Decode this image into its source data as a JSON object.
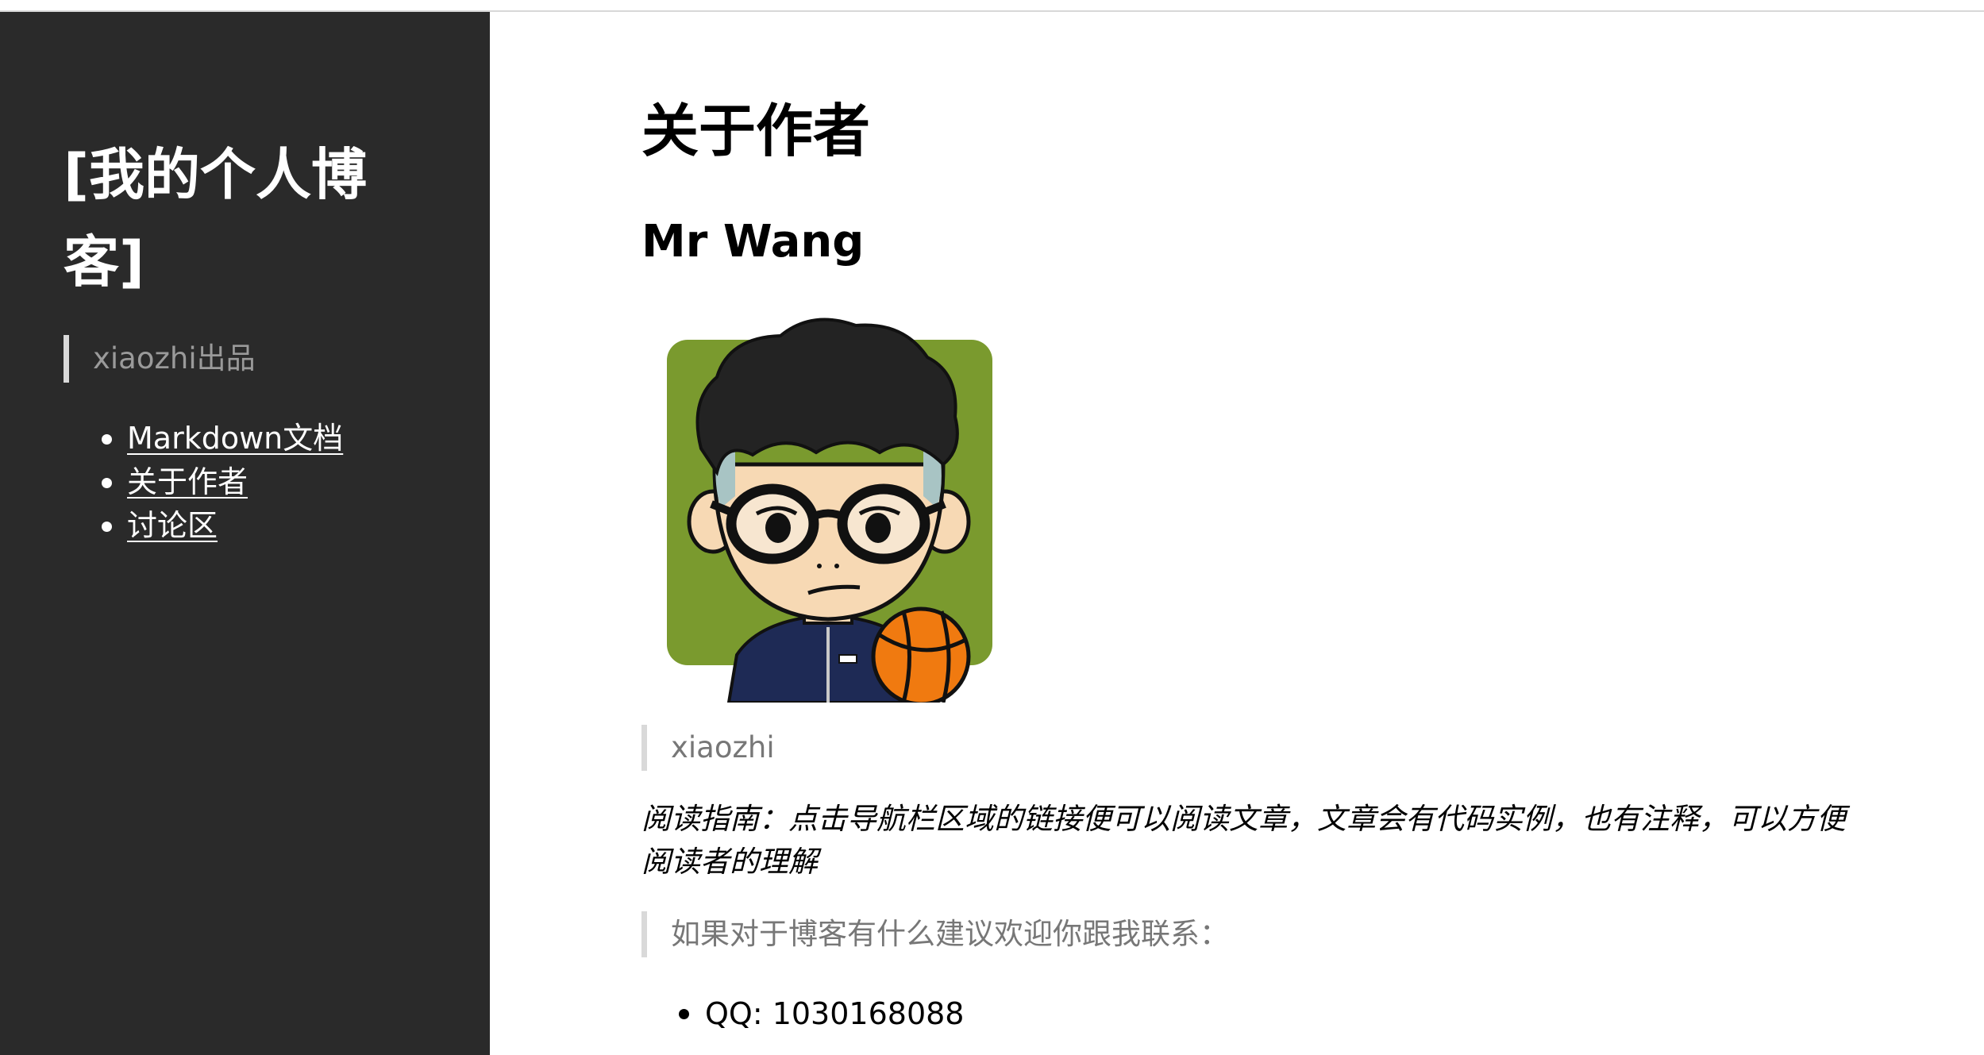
{
  "sidebar": {
    "title": "[我的个人博客]",
    "subtitle": "xiaozhi出品",
    "nav": [
      {
        "label": "Markdown文档"
      },
      {
        "label": "关于作者"
      },
      {
        "label": "讨论区"
      }
    ]
  },
  "main": {
    "heading": "关于作者",
    "author_name": "Mr Wang",
    "avatar_icon": "cartoon-avatar-basketball",
    "quote_name": "xiaozhi",
    "guide_text": "阅读指南：点击导航栏区域的链接便可以阅读文章，文章会有代码实例，也有注释，可以方便阅读者的理解",
    "contact_intro": "如果对于博客有什么建议欢迎你跟我联系：",
    "contacts": [
      {
        "label": "QQ: 1030168088"
      }
    ]
  },
  "colors": {
    "sidebar_bg": "#2a2a2a",
    "quote_border": "#d9d9d9",
    "quote_text": "#777777",
    "avatar_bg": "#7a9a2e",
    "ball": "#f07a10"
  }
}
